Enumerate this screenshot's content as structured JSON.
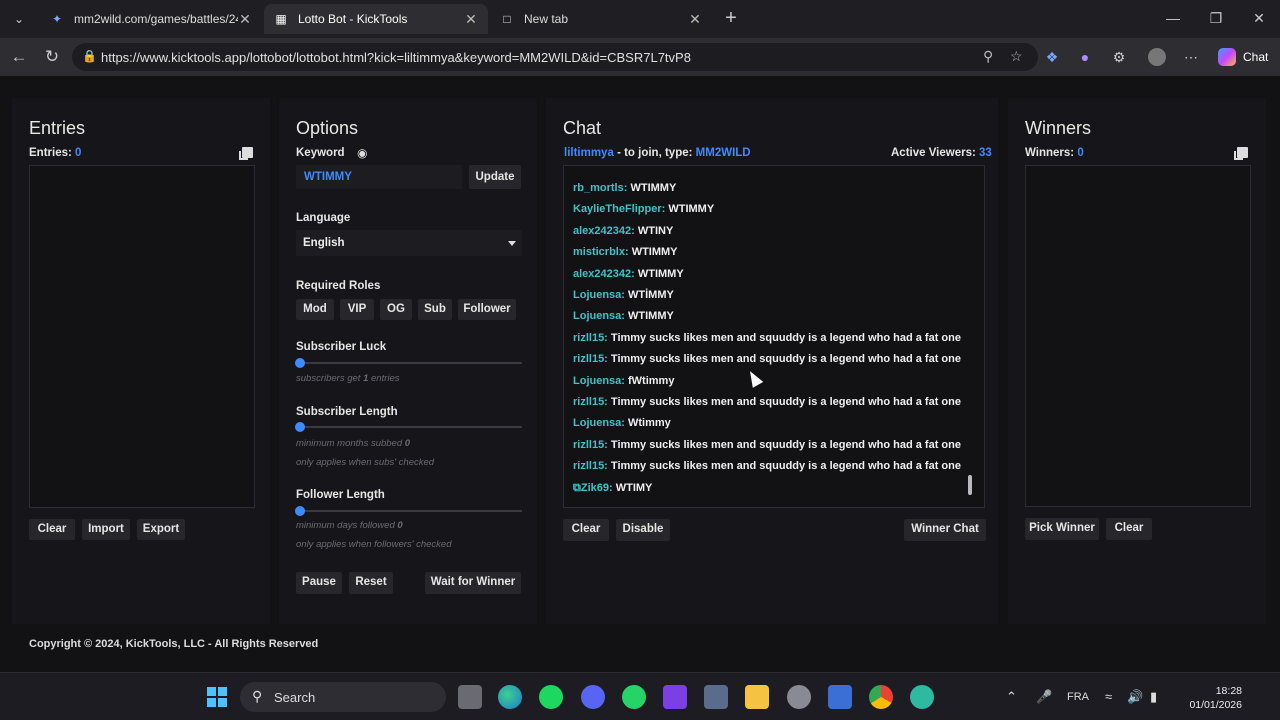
{
  "browser": {
    "tabs": [
      {
        "title": "mm2wild.com/games/battles/242·",
        "active": false
      },
      {
        "title": "Lotto Bot - KickTools",
        "active": true
      },
      {
        "title": "New tab",
        "active": false
      }
    ],
    "url": "https://www.kicktools.app/lottobot/lottobot.html?kick=liltimmya&keyword=MM2WILD&id=CBSR7L7tvP8",
    "chat_label": "Chat"
  },
  "entries": {
    "title": "Entries",
    "count_label": "Entries:",
    "count": "0",
    "buttons": {
      "clear": "Clear",
      "import": "Import",
      "export": "Export"
    }
  },
  "options": {
    "title": "Options",
    "keyword_label": "Keyword",
    "keyword_value": "WTIMMY",
    "update": "Update",
    "language_label": "Language",
    "language_value": "English",
    "roles_label": "Required Roles",
    "roles": [
      "Mod",
      "VIP",
      "OG",
      "Sub",
      "Follower"
    ],
    "sub_luck_label": "Subscriber Luck",
    "sub_luck_hint_pre": "subscribers get",
    "sub_luck_value": "1",
    "sub_luck_hint_post": "entries",
    "sub_length_label": "Subscriber Length",
    "sub_length_hint": "minimum months subbed",
    "sub_length_value": "0",
    "sub_length_hint2": "only applies when subs' checked",
    "follower_label": "Follower Length",
    "follower_hint": "minimum days followed",
    "follower_value": "0",
    "follower_hint2": "only applies when followers' checked",
    "pause": "Pause",
    "reset": "Reset",
    "wait": "Wait for Winner",
    "sliders": {
      "subscriber_luck": 0,
      "subscriber_length": 0,
      "follower_length": 0
    }
  },
  "chat": {
    "title": "Chat",
    "channel": "liltimmya",
    "join_text": "- to join, type:",
    "keyword": "MM2WILD",
    "viewers_label": "Active Viewers:",
    "viewers": "33",
    "messages": [
      {
        "user": "rb_mortls:",
        "text": "WTIMMY"
      },
      {
        "user": "KaylieTheFlipper:",
        "text": "WTIMMY"
      },
      {
        "user": "alex242342:",
        "text": "WTINY"
      },
      {
        "user": "misticrblx:",
        "text": "WTIMMY"
      },
      {
        "user": "alex242342:",
        "text": "WTIMMY"
      },
      {
        "user": "Lojuensa:",
        "text": "WTİMMY"
      },
      {
        "user": "Lojuensa:",
        "text": "WTIMMY"
      },
      {
        "user": "rizll15:",
        "text": "Timmy sucks likes men and squuddy is a legend who had a fat one"
      },
      {
        "user": "rizll15:",
        "text": "Timmy sucks likes men and squuddy is a legend who had a fat one"
      },
      {
        "user": "Lojuensa:",
        "text": "fWtimmy"
      },
      {
        "user": "rizll15:",
        "text": "Timmy sucks likes men and squuddy is a legend who had a fat one"
      },
      {
        "user": "Lojuensa:",
        "text": "Wtimmy"
      },
      {
        "user": "rizll15:",
        "text": "Timmy sucks likes men and squuddy is a legend who had a fat one"
      },
      {
        "user": "rizll15:",
        "text": "Timmy sucks likes men and squuddy is a legend who had a fat one"
      },
      {
        "user": "Zik69:",
        "text": "WTIMY",
        "badge": true
      }
    ],
    "buttons": {
      "clear": "Clear",
      "disable": "Disable",
      "winner_chat": "Winner Chat"
    }
  },
  "winners": {
    "title": "Winners",
    "count_label": "Winners:",
    "count": "0",
    "buttons": {
      "pick": "Pick Winner",
      "clear": "Clear"
    }
  },
  "footer": {
    "copyright": "Copyright © 2024, KickTools, LLC - All Rights Reserved"
  },
  "taskbar": {
    "search": "Search",
    "lang": "FRA",
    "time": "18:28",
    "date": "01/01/2026"
  }
}
